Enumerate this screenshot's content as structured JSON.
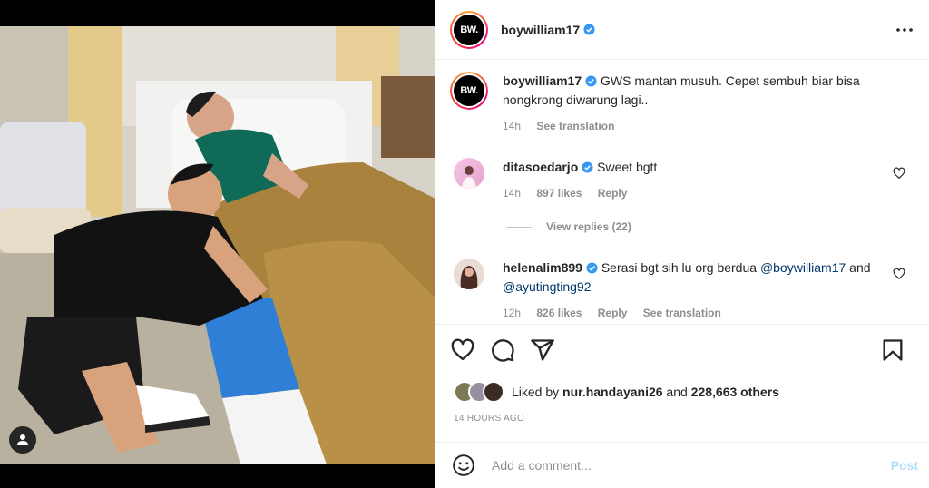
{
  "post": {
    "author": "boywilliam17",
    "author_avatar_text": "BW.",
    "more_icon": "more-horizontal-icon"
  },
  "caption": {
    "username": "boywilliam17",
    "text": "GWS mantan musuh. Cepet sembuh biar bisa nongkrong diwarung lagi..",
    "time": "14h",
    "see_translation": "See translation"
  },
  "comments": [
    {
      "username": "ditasoedarjo",
      "text": "Sweet bgtt",
      "time": "14h",
      "likes": "897 likes",
      "reply": "Reply"
    },
    {
      "username": "helenalim899",
      "text_before": "Serasi bgt sih lu org berdua ",
      "mention1": "@boywilliam17",
      "text_and": " and ",
      "mention2": "@ayutingting92",
      "time": "12h",
      "likes": "826 likes",
      "reply": "Reply",
      "see_translation": "See translation"
    }
  ],
  "view_replies": "View replies (22)",
  "actions": {
    "like_icon": "heart-icon",
    "comment_icon": "comment-icon",
    "share_icon": "share-icon",
    "save_icon": "bookmark-icon"
  },
  "liked_by": {
    "prefix": "Liked by ",
    "user": "nur.handayani26",
    "middle": " and ",
    "others": "228,663 others"
  },
  "timestamp": "14 HOURS AGO",
  "add_comment": {
    "placeholder": "Add a comment...",
    "post_label": "Post"
  },
  "colors": {
    "verified": "#3897f0",
    "link": "#00376b",
    "muted": "#8e8e8e",
    "post_disabled": "#b2dffc"
  }
}
